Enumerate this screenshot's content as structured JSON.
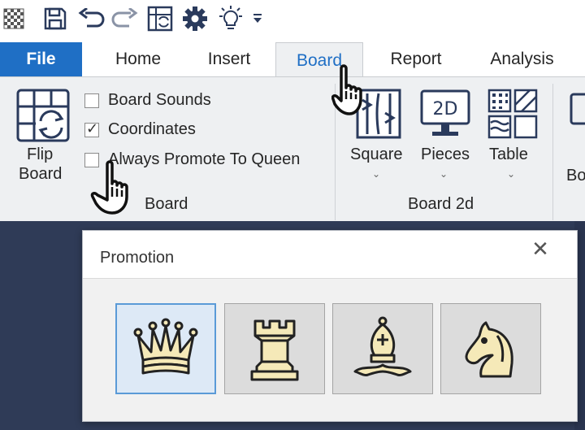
{
  "quick_access": {
    "icons": [
      "app-icon",
      "save-icon",
      "undo-icon",
      "redo-icon",
      "board-setup-icon",
      "settings-gear-icon",
      "lightbulb-icon",
      "customize-dropdown-icon"
    ]
  },
  "tabs": {
    "file": "File",
    "items": [
      "Home",
      "Insert",
      "Board",
      "Report",
      "Analysis"
    ],
    "active": "Board"
  },
  "ribbon": {
    "flip_board": {
      "line1": "Flip",
      "line2": "Board"
    },
    "checkboxes": [
      {
        "label": "Board Sounds",
        "checked": false
      },
      {
        "label": "Coordinates",
        "checked": true
      },
      {
        "label": "Always Promote To Queen",
        "checked": false
      }
    ],
    "group_board": "Board",
    "square": "Square",
    "pieces": "Pieces",
    "pieces_icon_text": "2D",
    "table": "Table",
    "group_board2d": "Board 2d",
    "cut_label": "Bo"
  },
  "dialog": {
    "title": "Promotion",
    "close": "✕",
    "pieces": [
      {
        "name": "queen",
        "selected": true
      },
      {
        "name": "rook",
        "selected": false
      },
      {
        "name": "bishop",
        "selected": false
      },
      {
        "name": "knight",
        "selected": false
      }
    ]
  },
  "colors": {
    "accent": "#1f6fc5",
    "ribbon_bg": "#eef0f2",
    "dark_bg": "#2f3b57",
    "piece_fill": "#f5e9b8",
    "selected_border": "#5a9ad7"
  }
}
